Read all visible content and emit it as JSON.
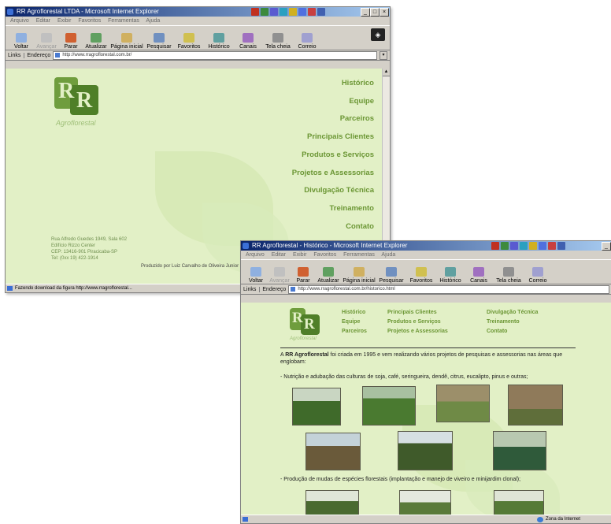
{
  "window1": {
    "title": "RR Agroflorestal LTDA - Microsoft Internet Explorer",
    "menu": [
      "Arquivo",
      "Editar",
      "Exibir",
      "Favoritos",
      "Ferramentas",
      "Ajuda"
    ],
    "toolbar": [
      "Voltar",
      "Avançar",
      "Parar",
      "Atualizar",
      "Página inicial",
      "Pesquisar",
      "Favoritos",
      "Histórico",
      "Canais",
      "Tela cheia",
      "Correio"
    ],
    "links_label": "Links",
    "address_label": "Endereço",
    "url": "http://www.rragroflorestal.com.br/",
    "logo_text": "Agroflorestal",
    "nav": [
      "Histórico",
      "Equipe",
      "Parceiros",
      "Principais Clientes",
      "Produtos e Serviços",
      "Projetos e Assessorias",
      "Divulgação Técnica",
      "Treinamento",
      "Contato"
    ],
    "address_lines": [
      "Rua Alfredo Guedes 1949, Sala 602",
      "Edifício Rizzo Center",
      "CEP: 13416-901 Piracicaba-SP",
      "Tel: (0xx 19) 422-1914"
    ],
    "producer": "Produzido por Luiz Carvalho de Oliveira Junior",
    "status": "Fazendo download da figura http://www.rragroflorestal..."
  },
  "window2": {
    "title": "RR Agroflorestal - Histórico - Microsoft Internet Explorer",
    "menu": [
      "Arquivo",
      "Editar",
      "Exibir",
      "Favoritos",
      "Ferramentas",
      "Ajuda"
    ],
    "toolbar": [
      "Voltar",
      "Avançar",
      "Parar",
      "Atualizar",
      "Página inicial",
      "Pesquisar",
      "Favoritos",
      "Histórico",
      "Canais",
      "Tela cheia",
      "Correio"
    ],
    "links_label": "Links",
    "address_label": "Endereço",
    "url": "http://www.rragroflorestal.com.br/historico.html",
    "logo_text": "Agroflorestal",
    "nav": [
      "Histórico",
      "Principais Clientes",
      "Divulgação Técnica",
      "Equipe",
      "Produtos e Serviços",
      "Treinamento",
      "Parceiros",
      "Projetos e Assessorias",
      "Contato"
    ],
    "intro_lead": "A ",
    "intro_brand": "RR Agroflorestal",
    "intro_rest": " foi criada em 1995 e vem realizando vários projetos de pesquisas e assessorias nas áreas que englobam:",
    "bullet1": "- Nutrição e adubação das culturas de soja, café, seringueira, dendê, citrus, eucalipto, pinus e outras;",
    "bullet2": "- Produção de mudas de espécies florestais (implantação e manejo de viveiro e minijardim clonal);",
    "status": "Zona da Internet"
  },
  "colors": {
    "page_bg": "#e2f0c6",
    "nav_green": "#6b9634",
    "logo_green": "#4f7f28",
    "chrome": "#d4d0c8",
    "title_bar": "#0a246a"
  }
}
